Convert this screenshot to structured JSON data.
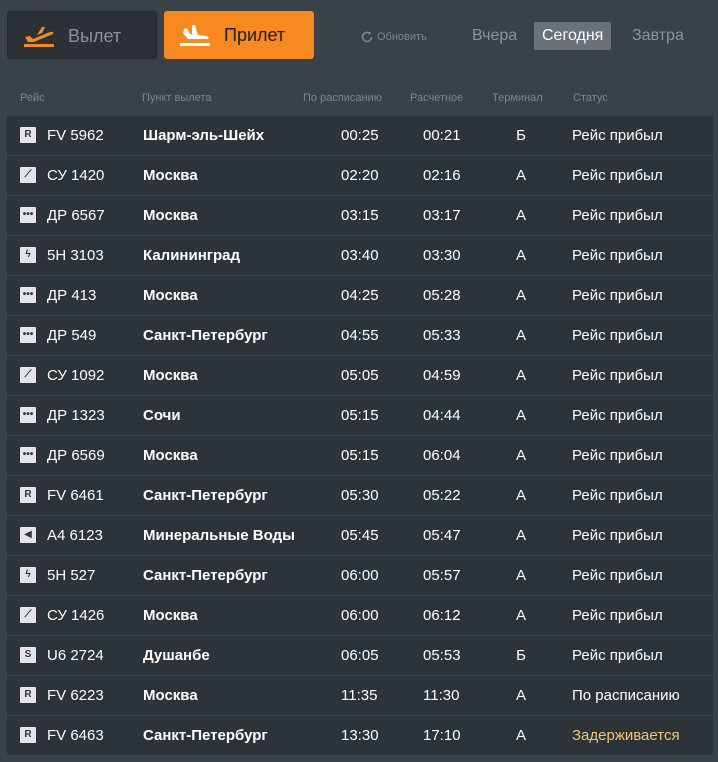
{
  "tabs": {
    "departure": "Вылет",
    "arrival": "Прилет"
  },
  "refresh_label": "Обновить",
  "days": {
    "yesterday": "Вчера",
    "today": "Сегодня",
    "tomorrow": "Завтра"
  },
  "columns": {
    "flight": "Рейс",
    "from": "Пункт вылета",
    "scheduled": "По расписанию",
    "estimated": "Расчетное",
    "terminal": "Терминал",
    "status": "Статус"
  },
  "colors": {
    "accent": "#f6891f",
    "background": "#3a4147",
    "row": "#2d3439",
    "delayed": "#f0c674"
  },
  "flights": [
    {
      "logo": "R",
      "logo_icon": "airline-logo-r-icon",
      "number": "FV 5962",
      "from": "Шарм-эль-Шейх",
      "scheduled": "00:25",
      "estimated": "00:21",
      "terminal": "Б",
      "status": "Рейс прибыл"
    },
    {
      "logo": "⟋",
      "logo_icon": "airline-logo-swoosh-icon",
      "number": "СУ 1420",
      "from": "Москва",
      "scheduled": "02:20",
      "estimated": "02:16",
      "terminal": "А",
      "status": "Рейс прибыл"
    },
    {
      "logo": "•••",
      "logo_icon": "airline-logo-dots-icon",
      "number": "ДР 6567",
      "from": "Москва",
      "scheduled": "03:15",
      "estimated": "03:17",
      "terminal": "А",
      "status": "Рейс прибыл"
    },
    {
      "logo": "ϟ",
      "logo_icon": "airline-logo-bolt-icon",
      "number": "5Н 3103",
      "from": "Калининград",
      "scheduled": "03:40",
      "estimated": "03:30",
      "terminal": "А",
      "status": "Рейс прибыл"
    },
    {
      "logo": "•••",
      "logo_icon": "airline-logo-dots-icon",
      "number": "ДР 413",
      "from": "Москва",
      "scheduled": "04:25",
      "estimated": "05:28",
      "terminal": "А",
      "status": "Рейс прибыл"
    },
    {
      "logo": "•••",
      "logo_icon": "airline-logo-dots-icon",
      "number": "ДР 549",
      "from": "Санкт-Петербург",
      "scheduled": "04:55",
      "estimated": "05:33",
      "terminal": "А",
      "status": "Рейс прибыл"
    },
    {
      "logo": "⟋",
      "logo_icon": "airline-logo-swoosh-icon",
      "number": "СУ 1092",
      "from": "Москва",
      "scheduled": "05:05",
      "estimated": "04:59",
      "terminal": "А",
      "status": "Рейс прибыл"
    },
    {
      "logo": "•••",
      "logo_icon": "airline-logo-dots-icon",
      "number": "ДР 1323",
      "from": "Сочи",
      "scheduled": "05:15",
      "estimated": "04:44",
      "terminal": "А",
      "status": "Рейс прибыл"
    },
    {
      "logo": "•••",
      "logo_icon": "airline-logo-dots-icon",
      "number": "ДР 6569",
      "from": "Москва",
      "scheduled": "05:15",
      "estimated": "06:04",
      "terminal": "А",
      "status": "Рейс прибыл"
    },
    {
      "logo": "R",
      "logo_icon": "airline-logo-r-icon",
      "number": "FV 6461",
      "from": "Санкт-Петербург",
      "scheduled": "05:30",
      "estimated": "05:22",
      "terminal": "А",
      "status": "Рейс прибыл"
    },
    {
      "logo": "◀",
      "logo_icon": "airline-logo-wing-icon",
      "number": "А4 6123",
      "from": "Минеральные Воды",
      "scheduled": "05:45",
      "estimated": "05:47",
      "terminal": "А",
      "status": "Рейс прибыл"
    },
    {
      "logo": "ϟ",
      "logo_icon": "airline-logo-bolt-icon",
      "number": "5Н 527",
      "from": "Санкт-Петербург",
      "scheduled": "06:00",
      "estimated": "05:57",
      "terminal": "А",
      "status": "Рейс прибыл"
    },
    {
      "logo": "⟋",
      "logo_icon": "airline-logo-swoosh-icon",
      "number": "СУ 1426",
      "from": "Москва",
      "scheduled": "06:00",
      "estimated": "06:12",
      "terminal": "А",
      "status": "Рейс прибыл"
    },
    {
      "logo": "S",
      "logo_icon": "airline-logo-bird-icon",
      "number": "U6 2724",
      "from": "Душанбе",
      "scheduled": "06:05",
      "estimated": "05:53",
      "terminal": "Б",
      "status": "Рейс прибыл"
    },
    {
      "logo": "R",
      "logo_icon": "airline-logo-r-icon",
      "number": "FV 6223",
      "from": "Москва",
      "scheduled": "11:35",
      "estimated": "11:30",
      "terminal": "А",
      "status": "По расписанию"
    },
    {
      "logo": "R",
      "logo_icon": "airline-logo-r-icon",
      "number": "FV 6463",
      "from": "Санкт-Петербург",
      "scheduled": "13:30",
      "estimated": "17:10",
      "terminal": "А",
      "status": "Задерживается",
      "delayed": true
    }
  ]
}
